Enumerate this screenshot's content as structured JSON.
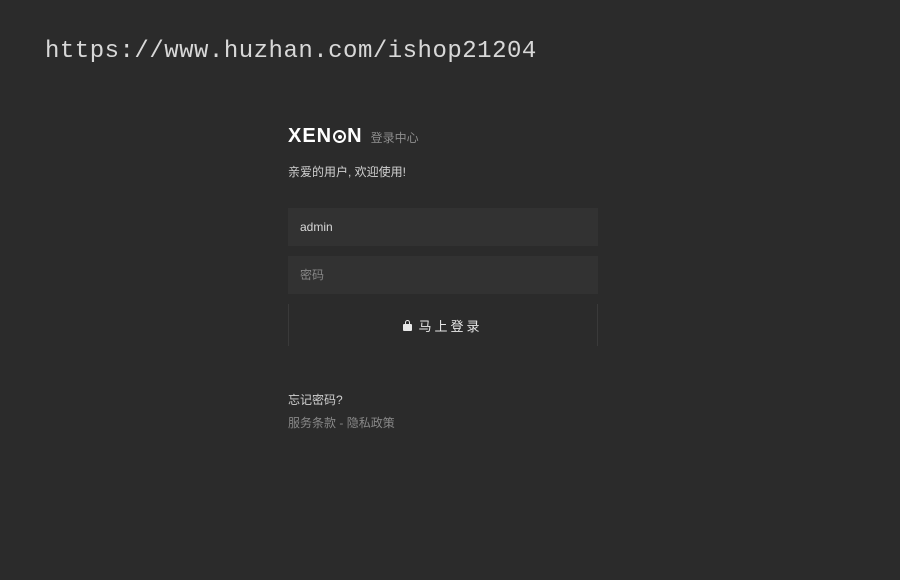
{
  "url": "https://www.huzhan.com/ishop21204",
  "logo": {
    "text_prefix": "XEN",
    "text_suffix": "N",
    "subtitle": "登录中心"
  },
  "welcome": "亲爱的用户, 欢迎使用!",
  "form": {
    "username_value": "admin",
    "password_placeholder": "密码",
    "login_button": "马上登录"
  },
  "links": {
    "forgot": "忘记密码?",
    "tos": "服务条款",
    "sep": " - ",
    "privacy": "隐私政策"
  }
}
